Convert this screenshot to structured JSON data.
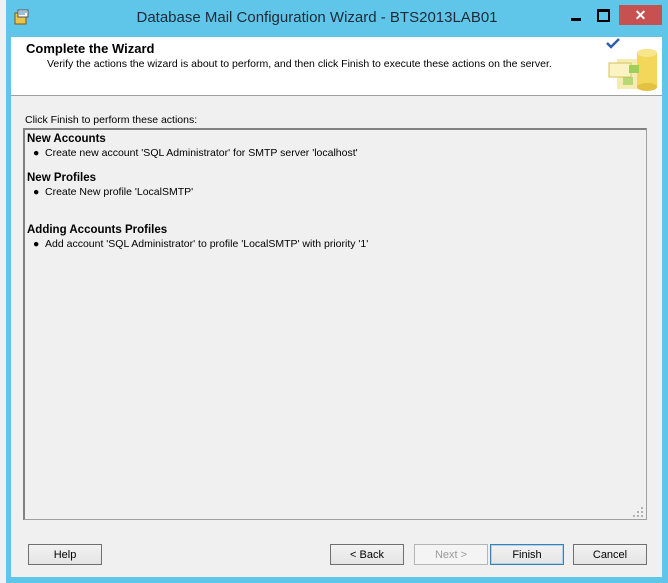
{
  "window": {
    "title": "Database Mail Configuration Wizard - BTS2013LAB01"
  },
  "header": {
    "title": "Complete the Wizard",
    "subtitle": "Verify the actions the wizard is about to perform, and then click Finish to execute these actions on the server."
  },
  "instruction": "Click Finish to perform these actions:",
  "sections": [
    {
      "title": "New Accounts",
      "items": [
        "Create new account 'SQL Administrator' for SMTP server 'localhost'"
      ]
    },
    {
      "title": "New Profiles",
      "items": [
        "Create New profile 'LocalSMTP'"
      ]
    },
    {
      "title": "Adding Accounts Profiles",
      "items": [
        "Add account 'SQL Administrator' to profile 'LocalSMTP' with priority '1'"
      ]
    }
  ],
  "buttons": {
    "help": "Help",
    "back": "< Back",
    "next": "Next >",
    "finish": "Finish",
    "cancel": "Cancel"
  },
  "colors": {
    "titlebar": "#5fc6ea",
    "close_button": "#c75050",
    "dialog_bg": "#f0f0f0"
  }
}
